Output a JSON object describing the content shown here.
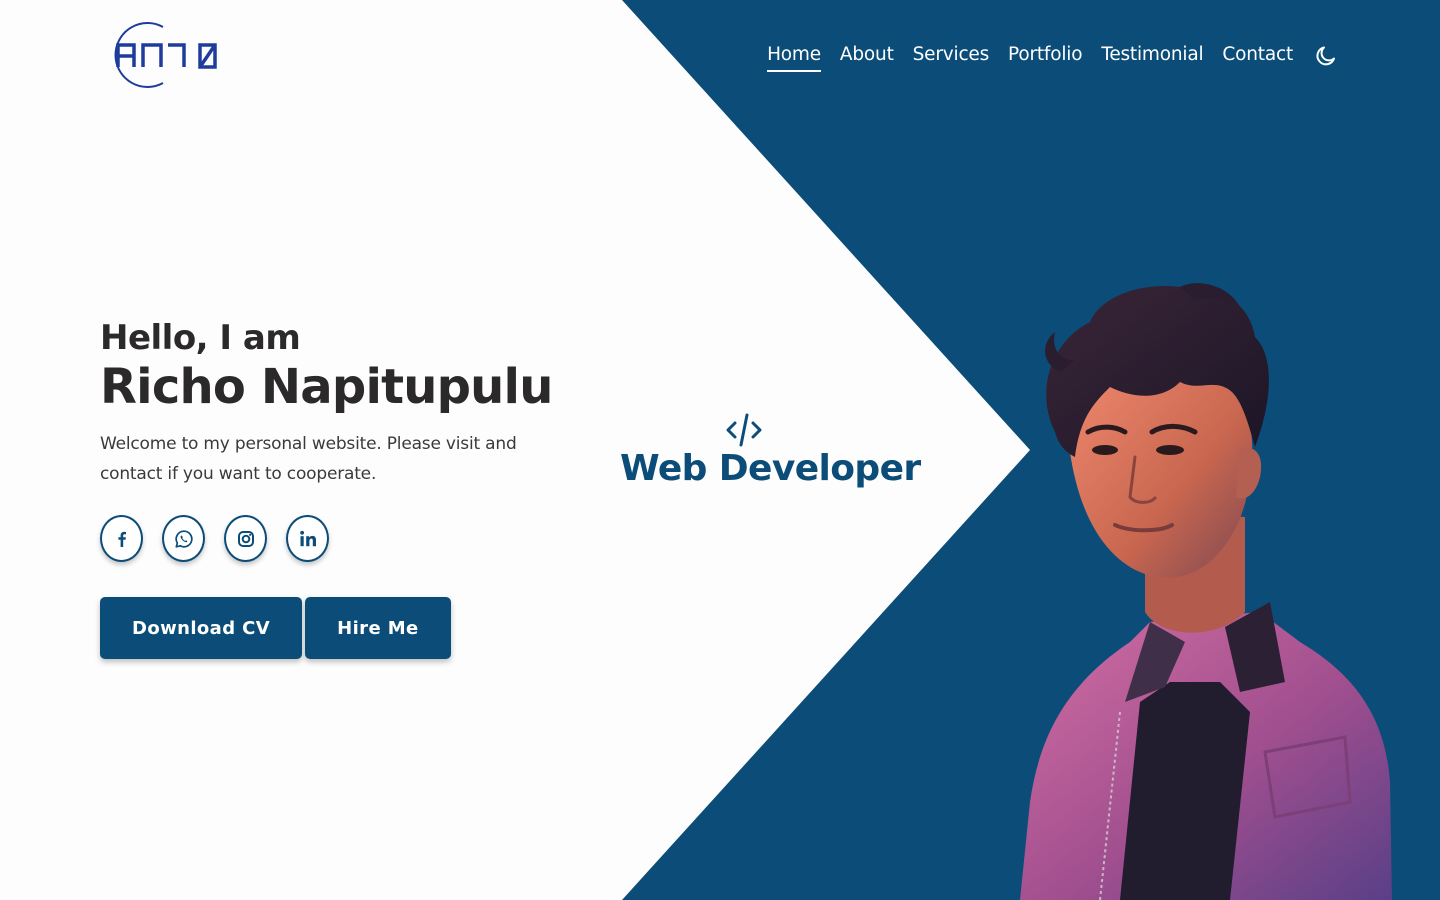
{
  "brand": {
    "logo_text": "AN7O",
    "logo_color": "#1e3c9c"
  },
  "nav": {
    "items": [
      {
        "label": "Home",
        "active": true
      },
      {
        "label": "About"
      },
      {
        "label": "Services"
      },
      {
        "label": "Portfolio"
      },
      {
        "label": "Testimonial"
      },
      {
        "label": "Contact"
      }
    ],
    "theme_toggle_icon": "moon-icon"
  },
  "hero": {
    "greeting": "Hello, I am",
    "name": "Richo Napitupulu",
    "description": "Welcome to my personal website. Please visit and contact if you want to cooperate.",
    "socials": [
      {
        "icon": "facebook-icon"
      },
      {
        "icon": "whatsapp-icon"
      },
      {
        "icon": "instagram-icon"
      },
      {
        "icon": "linkedin-icon"
      }
    ],
    "buttons": {
      "download_cv": "Download CV",
      "hire_me": "Hire Me"
    }
  },
  "role": {
    "icon": "code-icon",
    "label": "Web Developer"
  },
  "colors": {
    "primary": "#0b4d78",
    "text_dark": "#2b2929",
    "background": "#fdfdfe"
  }
}
